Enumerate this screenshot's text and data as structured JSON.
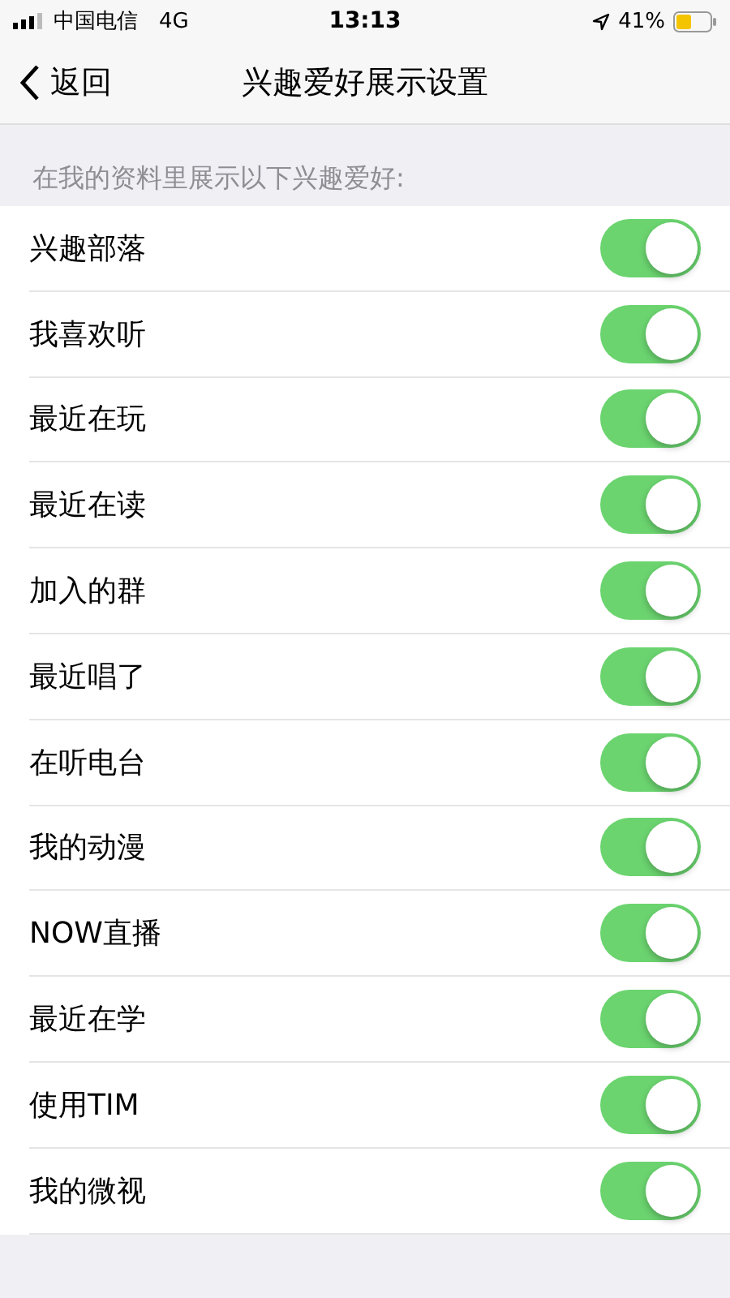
{
  "status_bar": {
    "carrier": "中国电信",
    "network": "4G",
    "time": "13:13",
    "battery": "41%"
  },
  "nav": {
    "back": "返回",
    "title": "兴趣爱好展示设置"
  },
  "section_header": "在我的资料里展示以下兴趣爱好:",
  "items": [
    {
      "label": "兴趣部落",
      "on": true
    },
    {
      "label": "我喜欢听",
      "on": true
    },
    {
      "label": "最近在玩",
      "on": true
    },
    {
      "label": "最近在读",
      "on": true
    },
    {
      "label": "加入的群",
      "on": true
    },
    {
      "label": "最近唱了",
      "on": true
    },
    {
      "label": "在听电台",
      "on": true
    },
    {
      "label": "我的动漫",
      "on": true
    },
    {
      "label": "NOW直播",
      "on": true
    },
    {
      "label": "最近在学",
      "on": true
    },
    {
      "label": "使用TIM",
      "on": true
    },
    {
      "label": "我的微视",
      "on": true
    }
  ]
}
